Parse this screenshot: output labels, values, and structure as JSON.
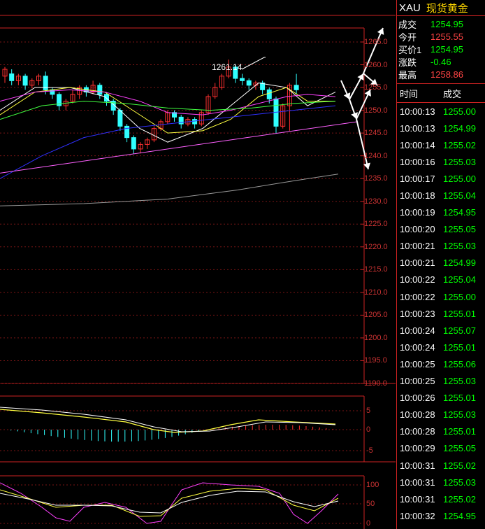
{
  "chart": {
    "peak_label": "1261.14",
    "price_axis": [
      "1265.0",
      "1260.0",
      "1255.0",
      "1250.0",
      "1245.0",
      "1240.0",
      "1235.0",
      "1230.0",
      "1225.0",
      "1220.0",
      "1215.0",
      "1210.0",
      "1205.0",
      "1200.0",
      "1195.0",
      "1190.0"
    ],
    "macd_axis": [
      "5",
      "0",
      "-5"
    ],
    "kdj_axis": [
      "100",
      "50",
      "0"
    ],
    "colors": {
      "up": "#ff3030",
      "down": "#30ffff",
      "ma5": "#ffffff",
      "ma10": "#ffff40",
      "ma20": "#ff40ff",
      "ma30": "#40ff40",
      "ma60": "#3030ff",
      "trend": "#ff60ff"
    }
  },
  "quote": {
    "symbol": "XAU",
    "name": "现货黄金",
    "rows": [
      {
        "label": "成交",
        "value": "1254.95",
        "color": "green"
      },
      {
        "label": "今开",
        "value": "1255.55",
        "color": "red"
      },
      {
        "label": "买价1",
        "value": "1254.95",
        "color": "green"
      },
      {
        "label": "涨跌",
        "value": "-0.46",
        "color": "green"
      },
      {
        "label": "最高",
        "value": "1258.86",
        "color": "red"
      }
    ]
  },
  "trades": {
    "header_time": "时间",
    "header_price": "成交",
    "rows": [
      {
        "time": "10:00:13",
        "price": "1255.00"
      },
      {
        "time": "10:00:13",
        "price": "1254.99"
      },
      {
        "time": "10:00:14",
        "price": "1255.02"
      },
      {
        "time": "10:00:16",
        "price": "1255.03"
      },
      {
        "time": "10:00:17",
        "price": "1255.00"
      },
      {
        "time": "10:00:18",
        "price": "1255.04"
      },
      {
        "time": "10:00:19",
        "price": "1254.95"
      },
      {
        "time": "10:00:20",
        "price": "1255.05"
      },
      {
        "time": "10:00:21",
        "price": "1255.03"
      },
      {
        "time": "10:00:21",
        "price": "1254.99"
      },
      {
        "time": "10:00:22",
        "price": "1255.04"
      },
      {
        "time": "10:00:22",
        "price": "1255.00"
      },
      {
        "time": "10:00:23",
        "price": "1255.01"
      },
      {
        "time": "10:00:24",
        "price": "1255.07"
      },
      {
        "time": "10:00:24",
        "price": "1255.01"
      },
      {
        "time": "10:00:25",
        "price": "1255.06"
      },
      {
        "time": "10:00:25",
        "price": "1255.03"
      },
      {
        "time": "10:00:26",
        "price": "1255.01"
      },
      {
        "time": "10:00:28",
        "price": "1255.03"
      },
      {
        "time": "10:00:28",
        "price": "1255.01"
      },
      {
        "time": "10:00:29",
        "price": "1255.05"
      },
      {
        "time": "10:00:31",
        "price": "1255.02"
      },
      {
        "time": "10:00:31",
        "price": "1255.03"
      },
      {
        "time": "10:00:31",
        "price": "1255.02"
      },
      {
        "time": "10:00:32",
        "price": "1254.95"
      }
    ]
  }
}
